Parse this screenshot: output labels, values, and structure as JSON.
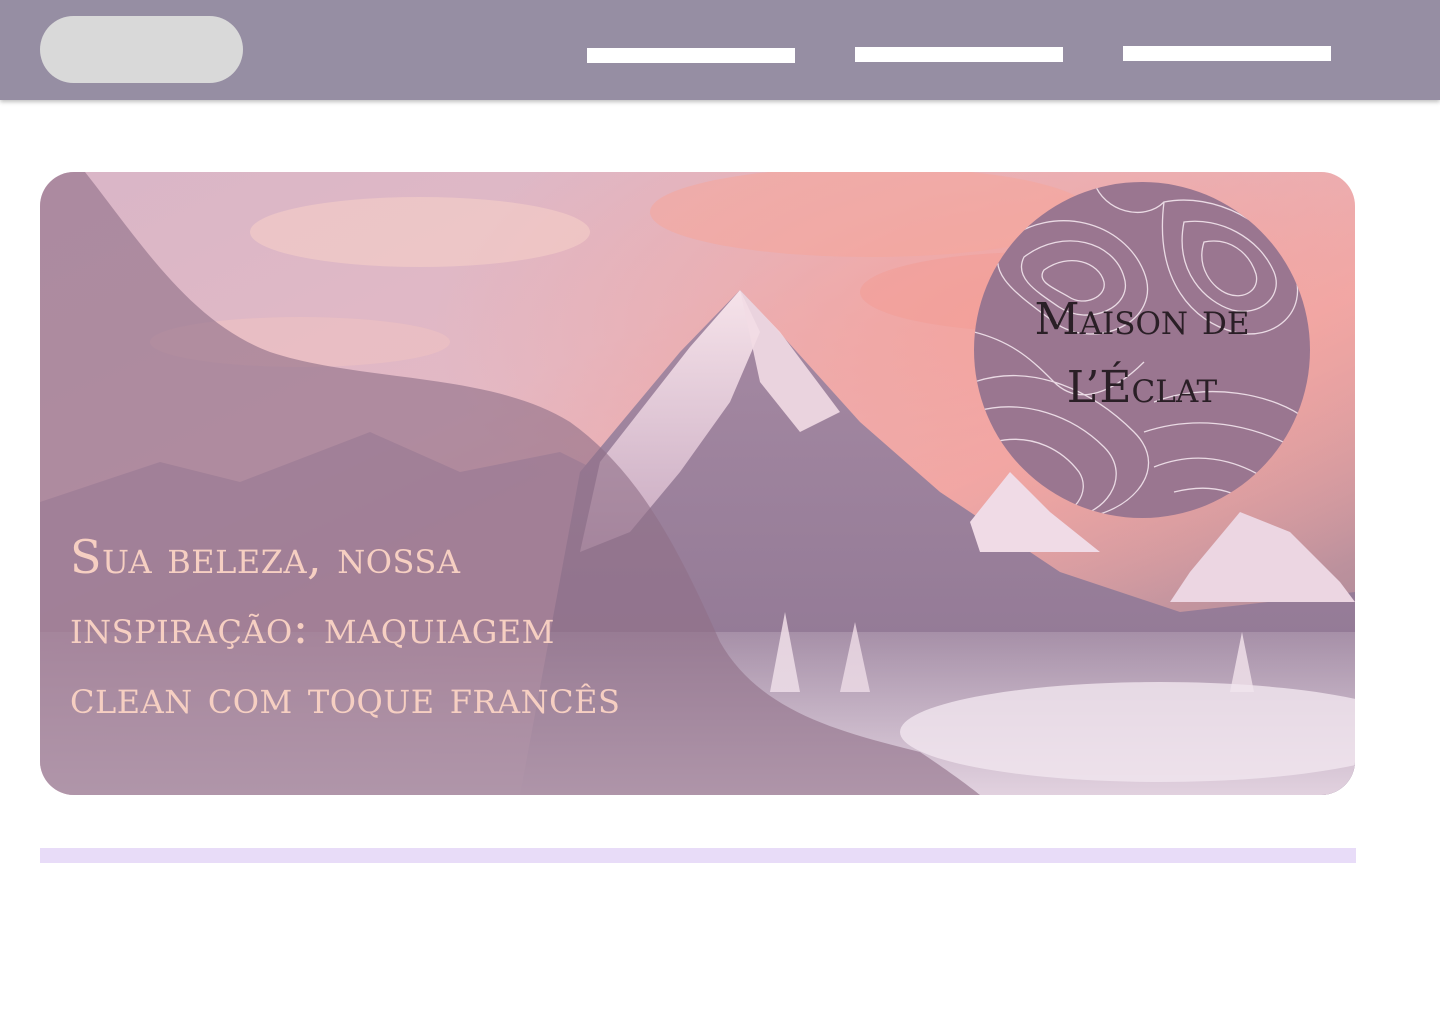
{
  "header": {
    "logo_placeholder": "logo-placeholder",
    "nav_items": [
      "nav-placeholder-1",
      "nav-placeholder-2",
      "nav-placeholder-3"
    ]
  },
  "hero": {
    "headline": "Sua beleza, nossa inspiração: maquiagem clean com toque francês",
    "background": "snowy mountain peak at sunset with pink clouds",
    "overlay_color": "#8f6f87"
  },
  "brand": {
    "name": "Maison de L’Éclat",
    "badge_color": "#9a7690",
    "contour_color": "#f3e6ee"
  },
  "colors": {
    "header_bg": "#968ea3",
    "divider": "#e8dcf8",
    "headline_text": "#f6cfc2"
  }
}
